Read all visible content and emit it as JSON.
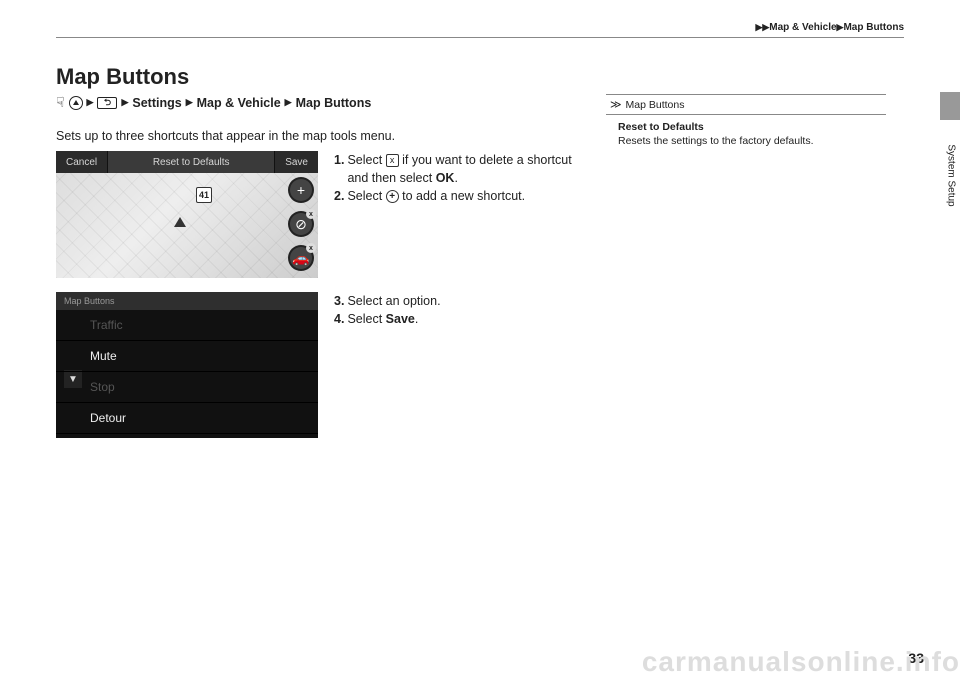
{
  "breadcrumb": {
    "level1": "Map & Vehicle",
    "level2": "Map Buttons"
  },
  "page": {
    "title": "Map Buttons",
    "number": "33"
  },
  "nav_path": {
    "settings": "Settings",
    "map_vehicle": "Map & Vehicle",
    "map_buttons": "Map Buttons"
  },
  "intro": "Sets up to three shortcuts that appear in the map tools menu.",
  "map_shot": {
    "cancel": "Cancel",
    "reset": "Reset to Defaults",
    "save": "Save",
    "shield": "41",
    "plus": "+"
  },
  "list_shot": {
    "title": "Map Buttons",
    "items": [
      "Traffic",
      "Mute",
      "Stop",
      "Detour"
    ]
  },
  "steps": {
    "s1a": "Select ",
    "s1b": " if you want to delete a shortcut and then select ",
    "s1c": "OK",
    "s1d": ".",
    "s2a": "Select ",
    "s2b": " to add a new shortcut.",
    "s3": "Select an option.",
    "s4a": "Select ",
    "s4b": "Save",
    "s4c": "."
  },
  "sidebar": {
    "tab": "System Setup",
    "box_title": "Map Buttons",
    "reset_title": "Reset to Defaults",
    "reset_body": "Resets the settings to the factory defaults."
  },
  "watermark": "carmanualsonline.info"
}
